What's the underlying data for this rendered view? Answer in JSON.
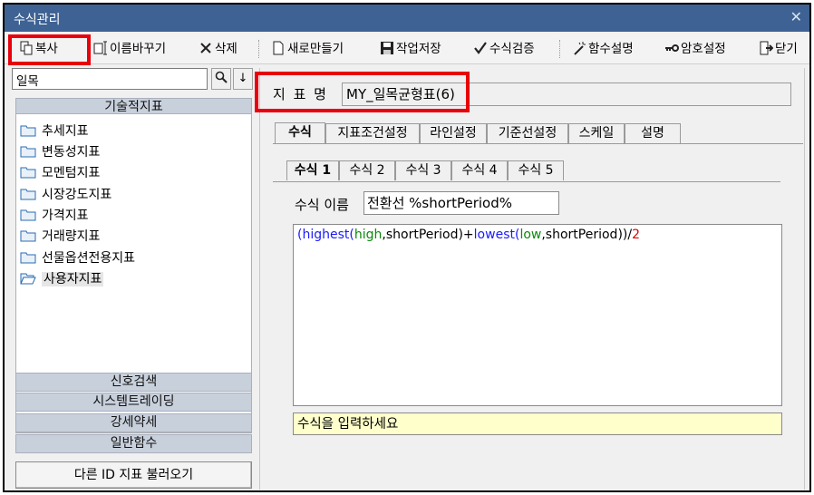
{
  "window": {
    "title": "수식관리",
    "close_glyph": "✕"
  },
  "toolbar": {
    "copy": "복사",
    "rename": "이름바꾸기",
    "delete": "삭제",
    "new": "새로만들기",
    "save": "작업저장",
    "verify": "수식검증",
    "func_desc": "함수설명",
    "password": "암호설정",
    "close": "닫기"
  },
  "search": {
    "value": "일목",
    "search_icon": "magnifier-icon",
    "down_glyph": "↓"
  },
  "sidebar": {
    "top_group": "기술적지표",
    "items": [
      {
        "label": "추세지표"
      },
      {
        "label": "변동성지표"
      },
      {
        "label": "모멘텀지표"
      },
      {
        "label": "시장강도지표"
      },
      {
        "label": "가격지표"
      },
      {
        "label": "거래량지표"
      },
      {
        "label": "선물옵션전용지표"
      },
      {
        "label": "사용자지표"
      }
    ],
    "groups": [
      "신호검색",
      "시스템트레이딩",
      "강세약세",
      "일반함수"
    ],
    "bottom_button": "다른 ID 지표 불러오기"
  },
  "indicator": {
    "label": "지 표 명",
    "value": "MY_일목균형표(6)"
  },
  "tabs": [
    "수식",
    "지표조건설정",
    "라인설정",
    "기준선설정",
    "스케일",
    "설명"
  ],
  "subtabs": [
    "수식 1",
    "수식 2",
    "수식 3",
    "수식 4",
    "수식 5"
  ],
  "formula": {
    "name_label": "수식 이름",
    "name_value": "전환선 %shortPeriod%",
    "tokens": {
      "t1": "(",
      "t2": "highest",
      "t3": "(",
      "t4": "high",
      "t5": ",shortPeriod)+",
      "t6": "lowest",
      "t7": "(",
      "t8": "low",
      "t9": ",shortPeriod))/",
      "t10": "2"
    },
    "hint": "수식을 입력하세요"
  },
  "colors": {
    "titlebar": "#3e6293",
    "highlight": "#e8000b",
    "function": "#1a1aff",
    "variable": "#0a8a0a",
    "number": "#e00000",
    "hint_bg": "#ffffcc"
  }
}
